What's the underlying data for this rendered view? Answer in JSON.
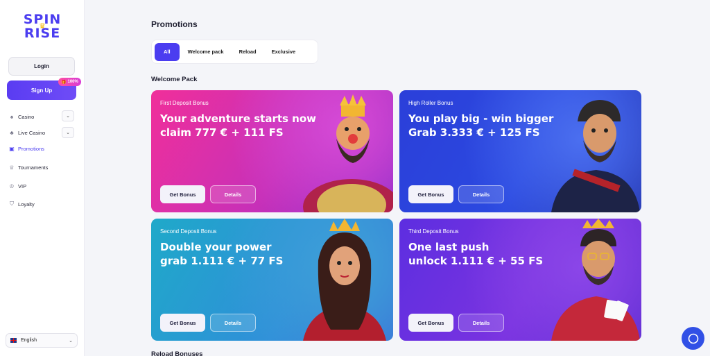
{
  "brand": {
    "line1": "SPIN",
    "line2": "RISE"
  },
  "sidebar": {
    "login_label": "Login",
    "signup_label": "Sign Up",
    "signup_badge": "100%",
    "items": [
      {
        "label": "Casino",
        "icon": "spade-icon",
        "has_chevron": true
      },
      {
        "label": "Live Casino",
        "icon": "club-icon",
        "has_chevron": true
      },
      {
        "label": "Promotions",
        "icon": "gift-icon",
        "active": true
      },
      {
        "label": "Tournaments",
        "icon": "trophy-icon"
      },
      {
        "label": "VIP",
        "icon": "crown-icon"
      },
      {
        "label": "Loyalty",
        "icon": "shield-icon"
      }
    ],
    "language": "English"
  },
  "main": {
    "title": "Promotions",
    "tabs": [
      {
        "label": "All",
        "active": true
      },
      {
        "label": "Welcome pack"
      },
      {
        "label": "Reload"
      },
      {
        "label": "Exclusive"
      }
    ],
    "welcome_section_title": "Welcome Pack",
    "cards": [
      {
        "kicker": "First Deposit Bonus",
        "line1": "Your adventure starts now",
        "line2": "claim 777 € + 111 FS",
        "get_label": "Get Bonus",
        "details_label": "Details"
      },
      {
        "kicker": "High Roller Bonus",
        "line1": "You play big - win bigger",
        "line2": "Grab 3.333 € + 125 FS",
        "get_label": "Get Bonus",
        "details_label": "Details"
      },
      {
        "kicker": "Second Deposit Bonus",
        "line1": "Double your power",
        "line2": "grab 1.111 € + 77 FS",
        "get_label": "Get Bonus",
        "details_label": "Details"
      },
      {
        "kicker": "Third Deposit Bonus",
        "line1": "One last push",
        "line2": "unlock 1.111 € + 55 FS",
        "get_label": "Get Bonus",
        "details_label": "Details"
      }
    ],
    "reload_section_title": "Reload Bonuses"
  },
  "colors": {
    "accent": "#4b3df0",
    "card1": "#e0309f",
    "card2": "#2b44dc",
    "card3": "#239fcf",
    "card4": "#6a31e0",
    "chat": "#3150e6"
  }
}
